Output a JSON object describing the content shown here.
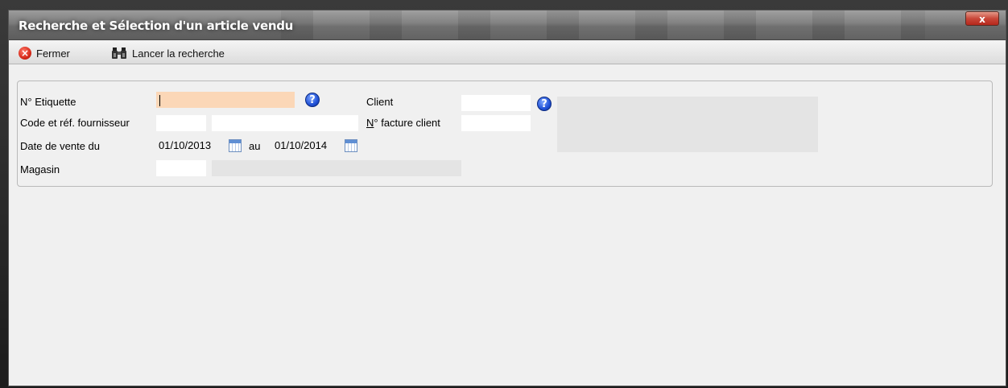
{
  "window": {
    "title": "Recherche et Sélection d'un article vendu",
    "close_label": "x"
  },
  "toolbar": {
    "close_label": "Fermer",
    "search_label": "Lancer la recherche"
  },
  "form": {
    "etiquette_label": "N° Etiquette",
    "etiquette_value": "",
    "code_ref_label": "Code et réf. fournisseur",
    "code_value": "",
    "ref_value": "",
    "date_label": "Date de vente du",
    "date_from": "01/10/2013",
    "date_separator": "au",
    "date_to": "01/10/2014",
    "magasin_label": "Magasin",
    "magasin_code": "",
    "magasin_name": "",
    "client_label": "Client",
    "client_value": "",
    "facture_label_prefix": "N",
    "facture_label_rest": "° facture client",
    "facture_value": "",
    "help_glyph": "?"
  },
  "colors": {
    "focused_field": "#fbd7b7",
    "readonly_field": "#e4e4e4",
    "close_button": "#c9483a"
  },
  "icons": {
    "close": "close-circle-icon",
    "search": "binoculars-icon",
    "help": "help-icon",
    "calendar": "calendar-icon"
  }
}
